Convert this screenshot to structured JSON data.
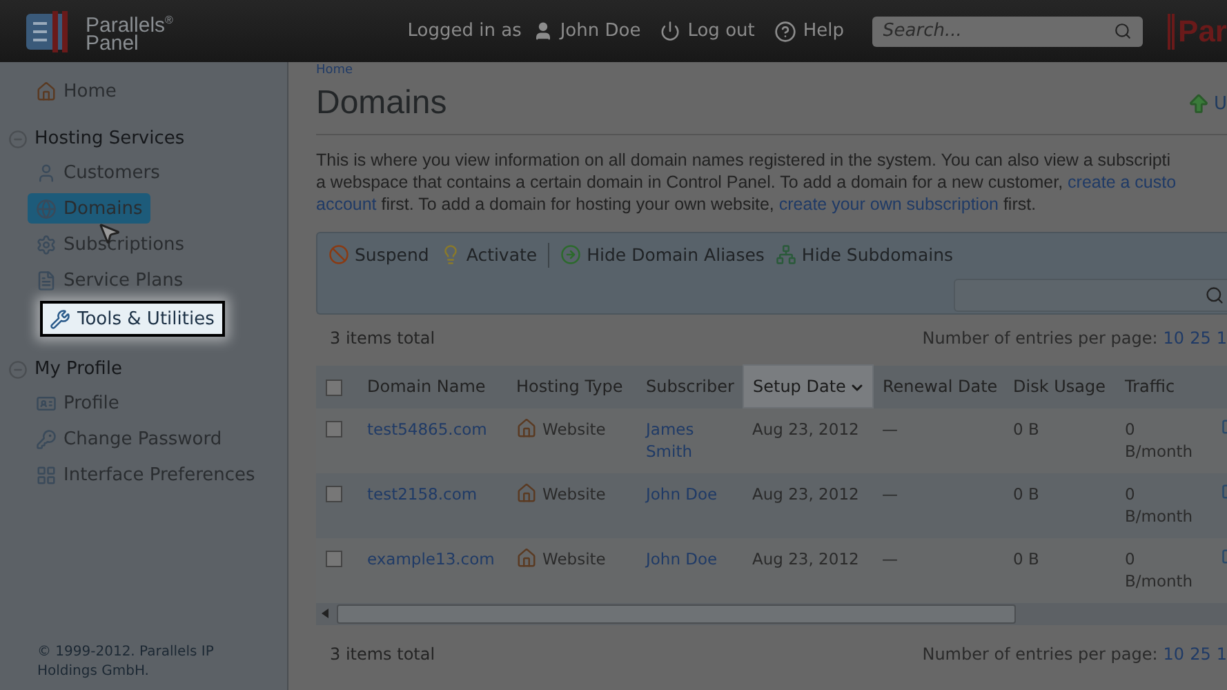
{
  "header": {
    "logo_name": "Parallels$^{®}$",
    "logo_product": "Panel",
    "logged_in_label": "Logged in as",
    "user": "John Doe",
    "logout": "Log out",
    "help": "Help",
    "search": {
      "placeholder": "Search..."
    },
    "brand_cut": "Par"
  },
  "sidebar": {
    "home": "Home",
    "groups": [
      {
        "title": "Hosting Services",
        "expanded": true,
        "items": [
          {
            "label": "Customers",
            "selected": false,
            "highlighted": false
          },
          {
            "label": "Domains",
            "selected": true,
            "highlighted": false
          },
          {
            "label": "Subscriptions",
            "selected": false,
            "highlighted": false
          },
          {
            "label": "Service Plans",
            "selected": false,
            "highlighted": false
          },
          {
            "label": "Tools & Utilities",
            "selected": false,
            "highlighted": true
          }
        ]
      },
      {
        "title": "My Profile",
        "expanded": true,
        "items": [
          {
            "label": "Profile",
            "selected": false,
            "highlighted": false
          },
          {
            "label": "Change Password",
            "selected": false,
            "highlighted": false
          },
          {
            "label": "Interface Preferences",
            "selected": false,
            "highlighted": false
          }
        ]
      }
    ],
    "footer": "© 1999-2012. Parallels IP Holdings GmbH."
  },
  "main": {
    "breadcrumb": "Home",
    "title": "Domains",
    "action_cut": "U",
    "description": [
      [
        {
          "text": "This is where you view information on all domain names registered in the system. You can also view a subscripti",
          "link": false
        }
      ],
      [
        {
          "text": "a webspace that contains a certain domain in Control Panel. To add a domain for a new customer, ",
          "link": false
        },
        {
          "text": "create a custo",
          "link": true
        }
      ],
      [
        {
          "text": "account",
          "link": true
        },
        {
          "text": " first. To add a domain for hosting your own website, ",
          "link": false
        },
        {
          "text": "create your own subscription",
          "link": true
        },
        {
          "text": " first.",
          "link": false
        }
      ]
    ],
    "toolbar": [
      {
        "kind": "button",
        "label": "Suspend"
      },
      {
        "kind": "button",
        "label": "Activate"
      },
      {
        "kind": "separator"
      },
      {
        "kind": "button",
        "label": "Hide Domain Aliases"
      },
      {
        "kind": "button",
        "label": "Hide Subdomains"
      }
    ],
    "list_top": {
      "total": "3 items total",
      "per_page_label": "Number of entries per page:",
      "per_page": [
        "10",
        "25",
        "1"
      ]
    },
    "table": {
      "select_all_checked": false,
      "columns": [
        {
          "label": "Domain Name",
          "sorted": false
        },
        {
          "label": "Hosting Type",
          "sorted": false
        },
        {
          "label": "Subscriber",
          "sorted": false
        },
        {
          "label": "Setup Date",
          "sorted": true
        },
        {
          "label": "Renewal Date",
          "sorted": false
        },
        {
          "label": "Disk Usage",
          "sorted": false
        },
        {
          "label": "Traffic",
          "sorted": false
        }
      ],
      "rows": [
        {
          "checked": false,
          "domain": "test54865.com",
          "hosting_type": "Website",
          "subscriber": "James Smith",
          "setup_date": "Aug 23, 2012",
          "renewal_date": "—",
          "disk_usage": "0 B",
          "traffic": "0 B/month"
        },
        {
          "checked": false,
          "domain": "test2158.com",
          "hosting_type": "Website",
          "subscriber": "John Doe",
          "setup_date": "Aug 23, 2012",
          "renewal_date": "—",
          "disk_usage": "0 B",
          "traffic": "0 B/month"
        },
        {
          "checked": false,
          "domain": "example13.com",
          "hosting_type": "Website",
          "subscriber": "John Doe",
          "setup_date": "Aug 23, 2012",
          "renewal_date": "—",
          "disk_usage": "0 B",
          "traffic": "0 B/month"
        }
      ]
    },
    "list_bottom": {
      "total": "3 items total",
      "per_page_label": "Number of entries per page:",
      "per_page": [
        "10",
        "25",
        "1"
      ]
    }
  }
}
